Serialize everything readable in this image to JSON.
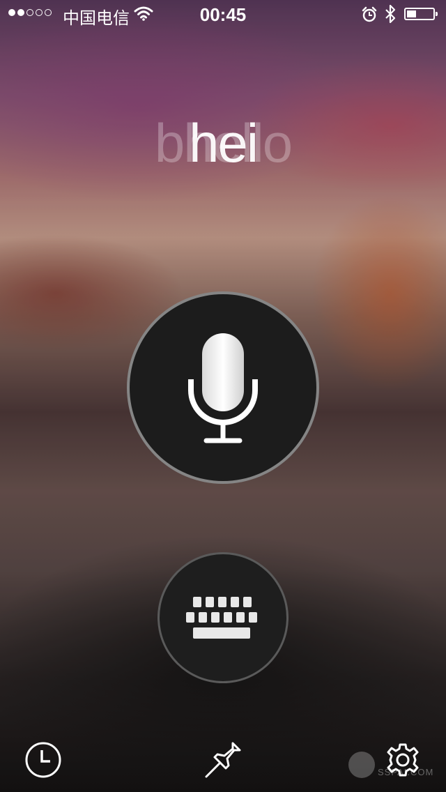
{
  "status_bar": {
    "carrier": "中国电信",
    "time": "00:45",
    "signal_bars_filled": 2,
    "signal_bars_total": 5,
    "battery_level": 0.35,
    "icons": [
      "wifi-icon",
      "alarm-icon",
      "bluetooth-icon",
      "battery-icon"
    ]
  },
  "recognition": {
    "candidate_text": "bhello",
    "recognized_text": "hei"
  },
  "controls": {
    "mic_icon": "microphone-icon",
    "keyboard_icon": "keyboard-icon"
  },
  "toolbar": {
    "items": [
      "history-clock-icon",
      "pin-icon",
      "gear-icon"
    ]
  },
  "watermark": {
    "text": "SSPAI.COM"
  },
  "colors": {
    "button_bg": "#1c1c1c",
    "icon": "#ffffff"
  }
}
